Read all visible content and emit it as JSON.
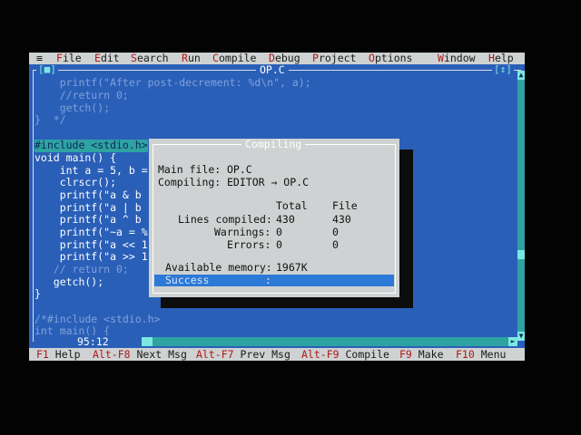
{
  "menu": {
    "system": "≡",
    "items": [
      {
        "hot": "F",
        "rest": "ile"
      },
      {
        "hot": "E",
        "rest": "dit"
      },
      {
        "hot": "S",
        "rest": "earch"
      },
      {
        "hot": "R",
        "rest": "un"
      },
      {
        "hot": "C",
        "rest": "ompile"
      },
      {
        "hot": "D",
        "rest": "ebug"
      },
      {
        "hot": "P",
        "rest": "roject"
      },
      {
        "hot": "O",
        "rest": "ptions"
      },
      {
        "hot": "W",
        "rest": "indow"
      },
      {
        "hot": "H",
        "rest": "elp"
      }
    ]
  },
  "editor": {
    "filename": "OP.C",
    "close_glyph": "[■]",
    "zoom_glyph": "[↕]",
    "cursor_pos": "95:12",
    "code_lines": [
      "    printf(\"After post-decrement: %d\\n\", a);",
      "    //return 0;",
      "    getch();",
      "}  */",
      "",
      "#include <stdio.h>",
      "void main() {",
      "    int a = 5, b = 3;",
      "    clrscr();",
      "    printf(\"a & b",
      "    printf(\"a | b",
      "    printf(\"a ^ b",
      "    printf(\"~a = %",
      "    printf(\"a << 1",
      "    printf(\"a >> 1",
      "   // return 0;",
      "   getch();",
      "}",
      "",
      "/*#include <stdio.h>",
      "int main() {"
    ]
  },
  "dialog": {
    "title": "Compiling",
    "main_file_label": "Main file:",
    "main_file": "OP.C",
    "compiling_label": "Compiling:",
    "compiling": "EDITOR → OP.C",
    "col_total": "Total",
    "col_file": "File",
    "rows": [
      {
        "label": "Lines compiled:",
        "total": "430",
        "file": "430"
      },
      {
        "label": "Warnings:",
        "total": "0",
        "file": "0"
      },
      {
        "label": "Errors:",
        "total": "0",
        "file": "0"
      }
    ],
    "memory_label": "Available memory:",
    "memory": "1967K",
    "result": "Success",
    "result_sep": ":"
  },
  "status": {
    "items": [
      {
        "key": "F1",
        "label": "Help"
      },
      {
        "key": "Alt-F8",
        "label": "Next Msg"
      },
      {
        "key": "Alt-F7",
        "label": "Prev Msg"
      },
      {
        "key": "Alt-F9",
        "label": "Compile"
      },
      {
        "key": "F9",
        "label": "Make"
      },
      {
        "key": "F10",
        "label": "Menu"
      }
    ]
  },
  "colors": {
    "editor_bg": "#2a5fb8",
    "menu_bg": "#cfd2d2",
    "hotkey": "#b01818",
    "dialog_bg": "#cfd2d2",
    "success_bar": "#2d79d8"
  }
}
